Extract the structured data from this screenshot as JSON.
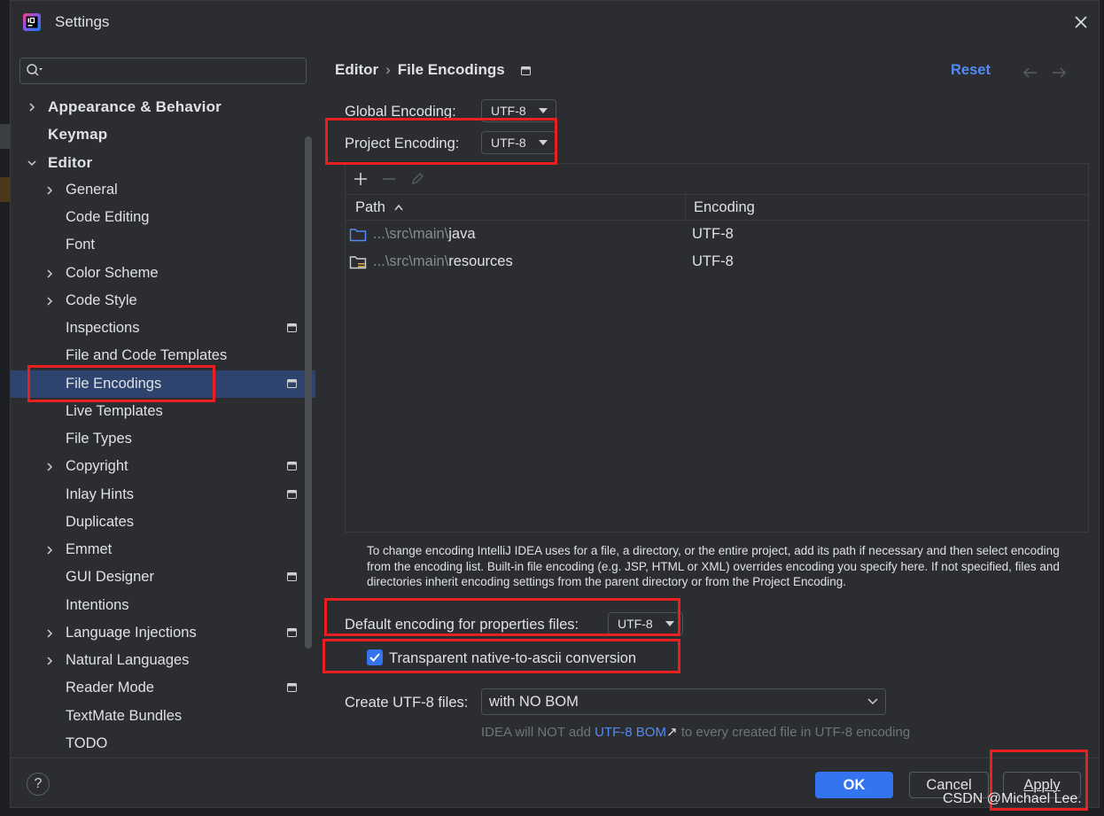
{
  "window": {
    "title": "Settings"
  },
  "sidebar": {
    "search_placeholder": "",
    "items": [
      {
        "label": "Appearance & Behavior",
        "level": 0,
        "expandable": true,
        "expanded": false,
        "project": false,
        "selected": false
      },
      {
        "label": "Keymap",
        "level": 0,
        "expandable": false,
        "expanded": false,
        "project": false,
        "selected": false
      },
      {
        "label": "Editor",
        "level": 0,
        "expandable": true,
        "expanded": true,
        "project": false,
        "selected": false
      },
      {
        "label": "General",
        "level": 1,
        "expandable": true,
        "expanded": false,
        "project": false,
        "selected": false
      },
      {
        "label": "Code Editing",
        "level": 1,
        "expandable": false,
        "expanded": false,
        "project": false,
        "selected": false
      },
      {
        "label": "Font",
        "level": 1,
        "expandable": false,
        "expanded": false,
        "project": false,
        "selected": false
      },
      {
        "label": "Color Scheme",
        "level": 1,
        "expandable": true,
        "expanded": false,
        "project": false,
        "selected": false
      },
      {
        "label": "Code Style",
        "level": 1,
        "expandable": true,
        "expanded": false,
        "project": false,
        "selected": false
      },
      {
        "label": "Inspections",
        "level": 1,
        "expandable": false,
        "expanded": false,
        "project": true,
        "selected": false
      },
      {
        "label": "File and Code Templates",
        "level": 1,
        "expandable": false,
        "expanded": false,
        "project": false,
        "selected": false
      },
      {
        "label": "File Encodings",
        "level": 1,
        "expandable": false,
        "expanded": false,
        "project": true,
        "selected": true
      },
      {
        "label": "Live Templates",
        "level": 1,
        "expandable": false,
        "expanded": false,
        "project": false,
        "selected": false
      },
      {
        "label": "File Types",
        "level": 1,
        "expandable": false,
        "expanded": false,
        "project": false,
        "selected": false
      },
      {
        "label": "Copyright",
        "level": 1,
        "expandable": true,
        "expanded": false,
        "project": true,
        "selected": false
      },
      {
        "label": "Inlay Hints",
        "level": 1,
        "expandable": false,
        "expanded": false,
        "project": true,
        "selected": false
      },
      {
        "label": "Duplicates",
        "level": 1,
        "expandable": false,
        "expanded": false,
        "project": false,
        "selected": false
      },
      {
        "label": "Emmet",
        "level": 1,
        "expandable": true,
        "expanded": false,
        "project": false,
        "selected": false
      },
      {
        "label": "GUI Designer",
        "level": 1,
        "expandable": false,
        "expanded": false,
        "project": true,
        "selected": false
      },
      {
        "label": "Intentions",
        "level": 1,
        "expandable": false,
        "expanded": false,
        "project": false,
        "selected": false
      },
      {
        "label": "Language Injections",
        "level": 1,
        "expandable": true,
        "expanded": false,
        "project": true,
        "selected": false
      },
      {
        "label": "Natural Languages",
        "level": 1,
        "expandable": true,
        "expanded": false,
        "project": false,
        "selected": false
      },
      {
        "label": "Reader Mode",
        "level": 1,
        "expandable": false,
        "expanded": false,
        "project": true,
        "selected": false
      },
      {
        "label": "TextMate Bundles",
        "level": 1,
        "expandable": false,
        "expanded": false,
        "project": false,
        "selected": false
      },
      {
        "label": "TODO",
        "level": 1,
        "expandable": false,
        "expanded": false,
        "project": false,
        "selected": false
      }
    ]
  },
  "header": {
    "breadcrumb_parent": "Editor",
    "breadcrumb_separator": "›",
    "breadcrumb_current": "File Encodings",
    "reset_label": "Reset"
  },
  "global_encoding": {
    "label": "Global Encoding:",
    "value": "UTF-8"
  },
  "project_encoding": {
    "label": "Project Encoding:",
    "value": "UTF-8"
  },
  "table": {
    "columns": [
      "Path",
      "Encoding"
    ],
    "sort_indicator": "^",
    "rows": [
      {
        "path_dim": "...\\src\\main\\",
        "path_name": "java",
        "encoding": "UTF-8",
        "icon": "source-folder-icon"
      },
      {
        "path_dim": "...\\src\\main\\",
        "path_name": "resources",
        "encoding": "UTF-8",
        "icon": "resources-folder-icon"
      }
    ]
  },
  "help_text": "To change encoding IntelliJ IDEA uses for a file, a directory, or the entire project, add its path if necessary and then select encoding from the encoding list. Built-in file encoding (e.g. JSP, HTML or XML) overrides encoding you specify here. If not specified, files and directories inherit encoding settings from the parent directory or from the Project Encoding.",
  "properties_encoding": {
    "label": "Default encoding for properties files:",
    "value": "UTF-8"
  },
  "native_to_ascii": {
    "label": "Transparent native-to-ascii conversion",
    "checked": true
  },
  "create_utf8": {
    "label": "Create UTF-8 files:",
    "value": "with NO BOM",
    "note_prefix": "IDEA will NOT add ",
    "note_link": "UTF-8 BOM",
    "note_link_arrow": "↗",
    "note_suffix": " to every created file in UTF-8 encoding"
  },
  "footer": {
    "help_label": "?",
    "ok_label": "OK",
    "cancel_label": "Cancel",
    "apply_label": "Apply"
  },
  "watermark": "CSDN @Michael Lee.",
  "colors": {
    "background": "#2b2d30",
    "selection": "#2e436e",
    "accent": "#3574f0",
    "link": "#548af7",
    "highlight_box": "#e8201f"
  }
}
